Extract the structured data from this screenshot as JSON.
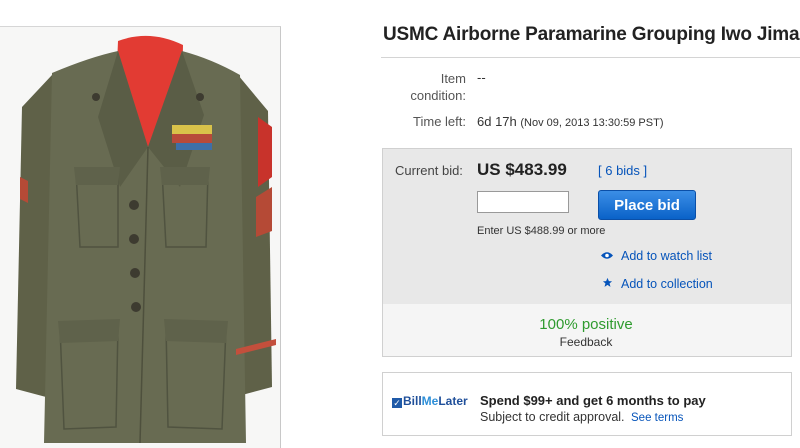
{
  "listing": {
    "title": "USMC Airborne Paramarine Grouping Iwo Jima"
  },
  "details": {
    "condition_label_line1": "Item",
    "condition_label_line2": "condition:",
    "condition_value": "--",
    "time_left_label": "Time left:",
    "time_left_value": "6d 17h",
    "end_date": "(Nov 09, 2013  13:30:59 PST)"
  },
  "bidding": {
    "current_bid_label": "Current bid:",
    "current_bid_value": "US $483.99",
    "bids_link": "[ 6 bids ]",
    "bid_input_value": "",
    "place_bid_label": "Place bid",
    "enter_hint": "Enter US $488.99 or more",
    "watch_label": "Add to watch list",
    "watch_icon": "eye-icon",
    "collection_label": "Add to collection",
    "collection_icon": "star-icon"
  },
  "seller_feedback": {
    "percent": "100% positive",
    "label": "Feedback"
  },
  "bill_me_later": {
    "logo_check": "✓",
    "logo_bill": "Bill",
    "logo_me": "Me",
    "logo_later": "Later",
    "offer": "Spend $99+ and get 6 months to pay",
    "subtext": "Subject to credit approval.",
    "terms_link": "See terms"
  },
  "colors": {
    "link_blue": "#0654ba",
    "positive_green": "#2f9b2f",
    "place_bid_blue": "#1a6fd6",
    "bid_panel_gray": "#e8e8e8"
  }
}
